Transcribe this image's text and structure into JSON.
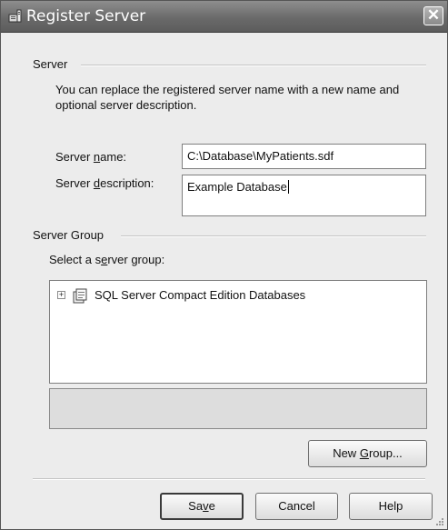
{
  "window": {
    "title": "Register Server",
    "close_glyph": "✕"
  },
  "server_section": {
    "heading": "Server",
    "description": "You can replace the registered server name with a new name and optional server description.",
    "name_label_pre": "Server ",
    "name_label_u": "n",
    "name_label_post": "ame:",
    "name_value": "C:\\Database\\MyPatients.sdf",
    "desc_label_pre": "Server ",
    "desc_label_u": "d",
    "desc_label_post": "escription:",
    "desc_value": "Example Database"
  },
  "group_section": {
    "heading": "Server Group",
    "select_pre": "Select a s",
    "select_u": "e",
    "select_post": "rver group:",
    "tree_items": [
      {
        "expander": "+",
        "label": "SQL Server Compact Edition Databases",
        "icon": "server-group-icon"
      }
    ]
  },
  "buttons": {
    "new_group_pre": "New ",
    "new_group_u": "G",
    "new_group_post": "roup...",
    "save_pre": "Sa",
    "save_u": "v",
    "save_post": "e",
    "cancel": "Cancel",
    "help": "Help"
  },
  "icons": {
    "title": "register-server-icon",
    "tree_node": "server-group-icon",
    "grip": "resize-grip-icon"
  }
}
